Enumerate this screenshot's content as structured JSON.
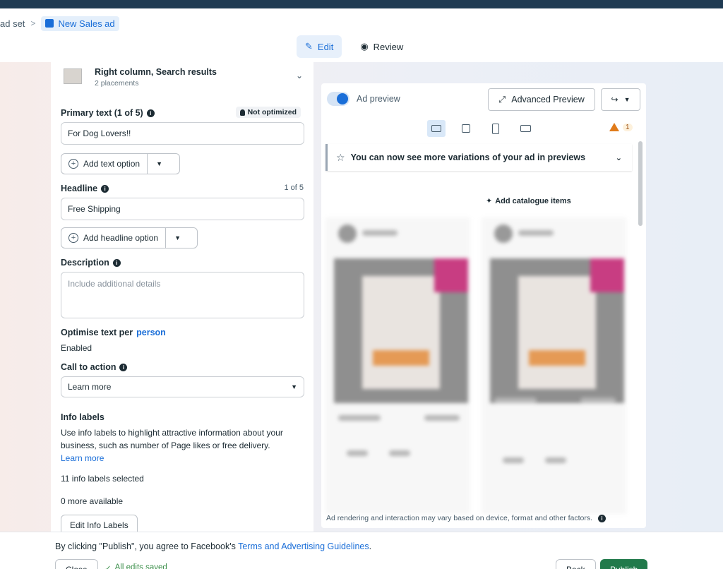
{
  "breadcrumb": {
    "prev_label": "ad set",
    "separator": ">",
    "current_label": "New Sales ad"
  },
  "mode_tabs": {
    "edit_label": "Edit",
    "review_label": "Review"
  },
  "placement": {
    "title": "Right column, Search results",
    "subtitle": "2 placements"
  },
  "primary_text": {
    "label": "Primary text (1 of 5)",
    "status": "Not optimized",
    "value": "For Dog Lovers!!",
    "add_button": "Add text option"
  },
  "headline": {
    "label": "Headline",
    "count": "1 of 5",
    "value": "Free Shipping",
    "add_button": "Add headline option"
  },
  "description": {
    "label": "Description",
    "placeholder": "Include additional details"
  },
  "optimise": {
    "label_prefix": "Optimise text per ",
    "label_link": "person",
    "value": "Enabled"
  },
  "cta": {
    "label": "Call to action",
    "selected": "Learn more"
  },
  "info_labels": {
    "title": "Info labels",
    "description": "Use info labels to highlight attractive information about your business, such as number of Page likes or free delivery.",
    "learn_more": "Learn more",
    "selected_count": "11 info labels selected",
    "available": "0 more available",
    "edit_button": "Edit Info Labels"
  },
  "preview": {
    "toggle_label": "Ad preview",
    "advanced_button": "Advanced Preview",
    "warning_count": "1",
    "banner_text": "You can now see more variations of your ad in previews",
    "catalogue_label": "Add catalogue items",
    "disclaimer": "Ad rendering and interaction may vary based on device, format and other factors."
  },
  "footer": {
    "terms_prefix": "By clicking \"Publish\", you agree to Facebook's ",
    "terms_link": "Terms and Advertising Guidelines",
    "terms_suffix": ".",
    "close_button": "Close",
    "saved_status": "All edits saved",
    "back_button": "Back",
    "publish_button": "Publish"
  },
  "colors": {
    "accent": "#1a6ed8",
    "publish": "#217a4b",
    "warning": "#e07b1a"
  },
  "icons": [
    "pencil-icon",
    "eye-icon",
    "info-icon",
    "bulb-icon",
    "plus-circle-icon",
    "caret-down-icon",
    "chevron-down-icon",
    "expand-icon",
    "share-icon",
    "desktop-icon",
    "square-icon",
    "phone-icon",
    "landscape-icon",
    "warning-icon",
    "star-icon",
    "sparkle-icon",
    "check-icon"
  ]
}
